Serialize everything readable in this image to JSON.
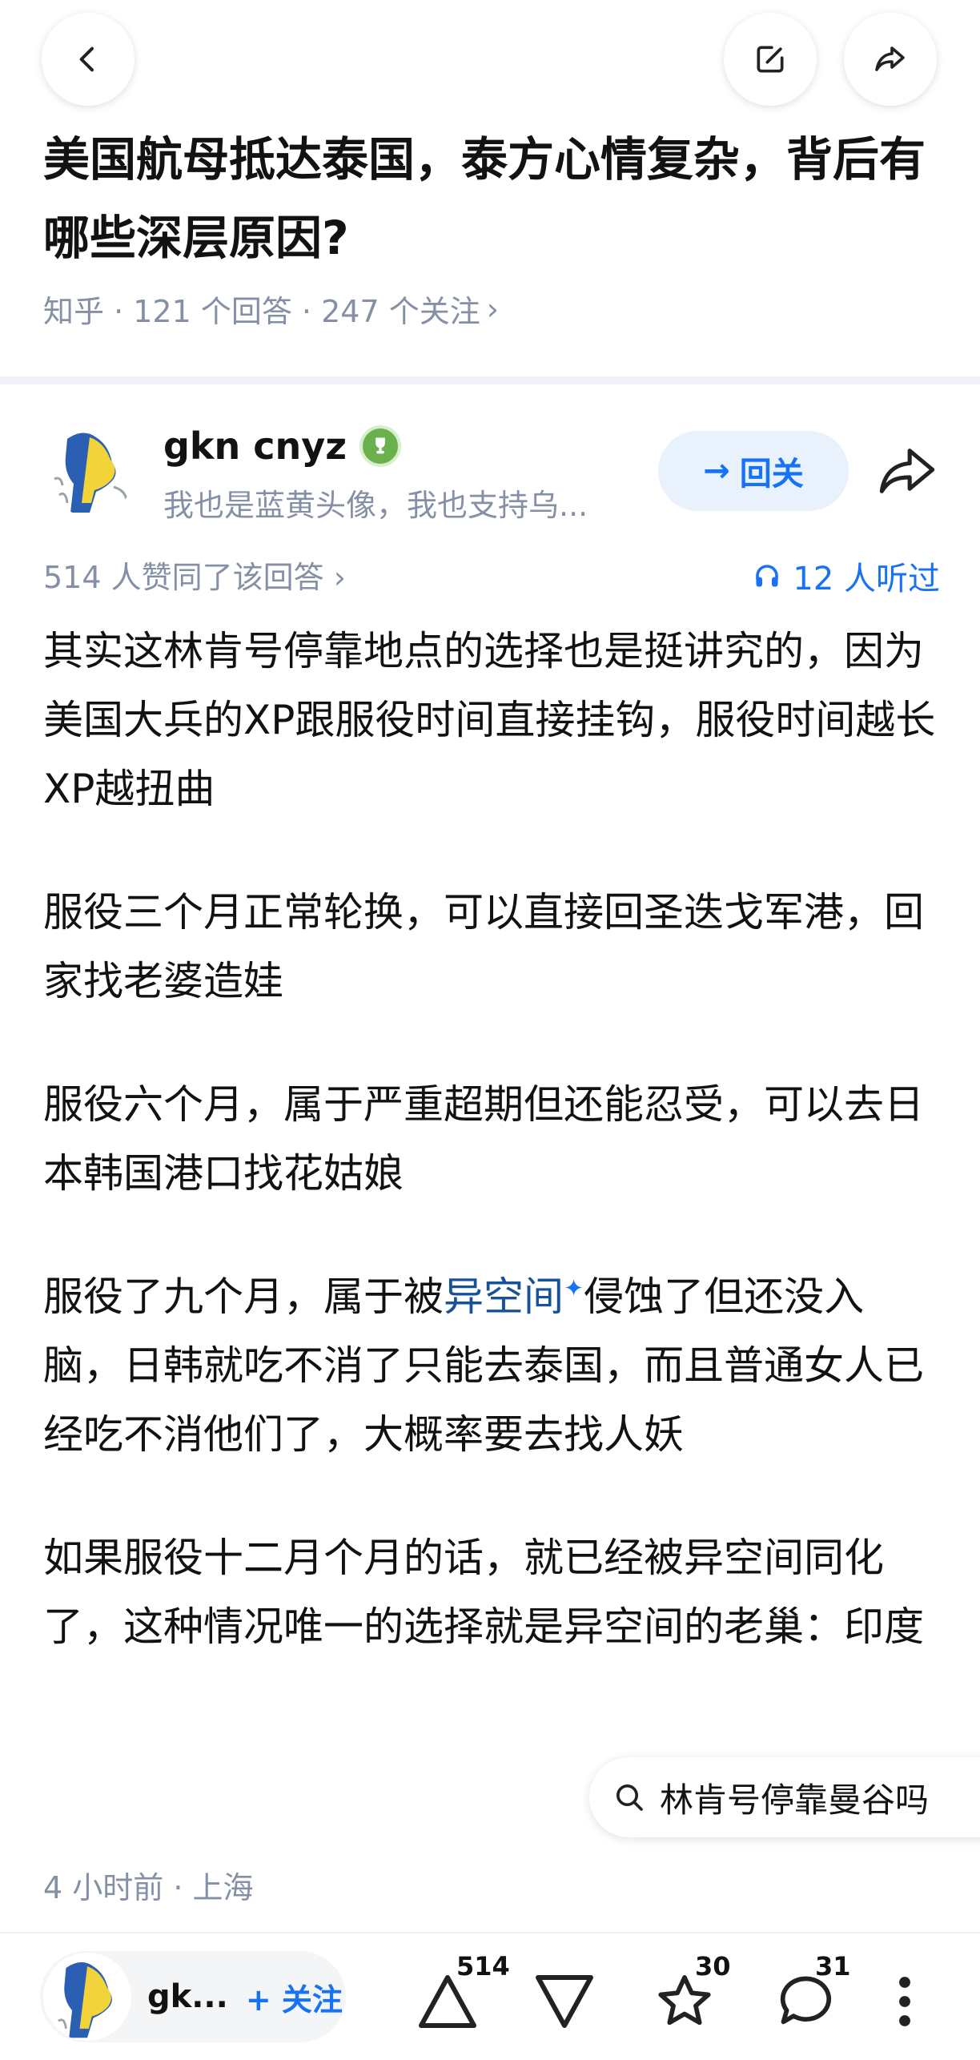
{
  "question": {
    "title": "美国航母抵达泰国，泰方心情复杂，背后有哪些深层原因?",
    "meta": "知乎 · 121 个回答 · 247 个关注",
    "meta_chevron": "›"
  },
  "author": {
    "name": "gkn cnyz",
    "bio": "我也是蓝黄头像，我也支持乌...",
    "follow_label": "回关",
    "follow_arrow": "→"
  },
  "answer": {
    "upvote_summary": "514 人赞同了该回答 ›",
    "listened": "12 人听过",
    "paragraphs": {
      "p1": "其实这林肯号停靠地点的选择也是挺讲究的，因为美国大兵的XP跟服役时间直接挂钩，服役时间越长XP越扭曲",
      "p2": "服役三个月正常轮换，可以直接回圣迭戈军港，回家找老婆造娃",
      "p3": "服役六个月，属于严重超期但还能忍受，可以去日本韩国港口找花姑娘",
      "p4_before": "服役了九个月，属于被",
      "p4_keyword": "异空间",
      "p4_star": "✦",
      "p4_after": "侵蚀了但还没入脑，日韩就吃不消了只能去泰国，而且普通女人已经吃不消他们了，大概率要去找人妖",
      "p5": "如果服役十二月个月的话，就已经被异空间同化了，这种情况唯一的选择就是异空间的老巢：印度"
    },
    "time_location": "4 小时前 · 上海"
  },
  "search_suggestion": "林肯号停靠曼谷吗",
  "bottom_bar": {
    "author_short": "gk...",
    "follow_label": "+ 关注",
    "upvote_count": "514",
    "favorite_count": "30",
    "comment_count": "31"
  },
  "colors": {
    "brand_blue": "#1772f6",
    "muted_gray": "#8590a6",
    "keyword_blue": "#175199"
  },
  "icons": [
    "back-icon",
    "edit-icon",
    "share-icon",
    "listen-icon",
    "search-icon",
    "upvote-icon",
    "downvote-icon",
    "star-icon",
    "comment-icon",
    "more-icon"
  ]
}
